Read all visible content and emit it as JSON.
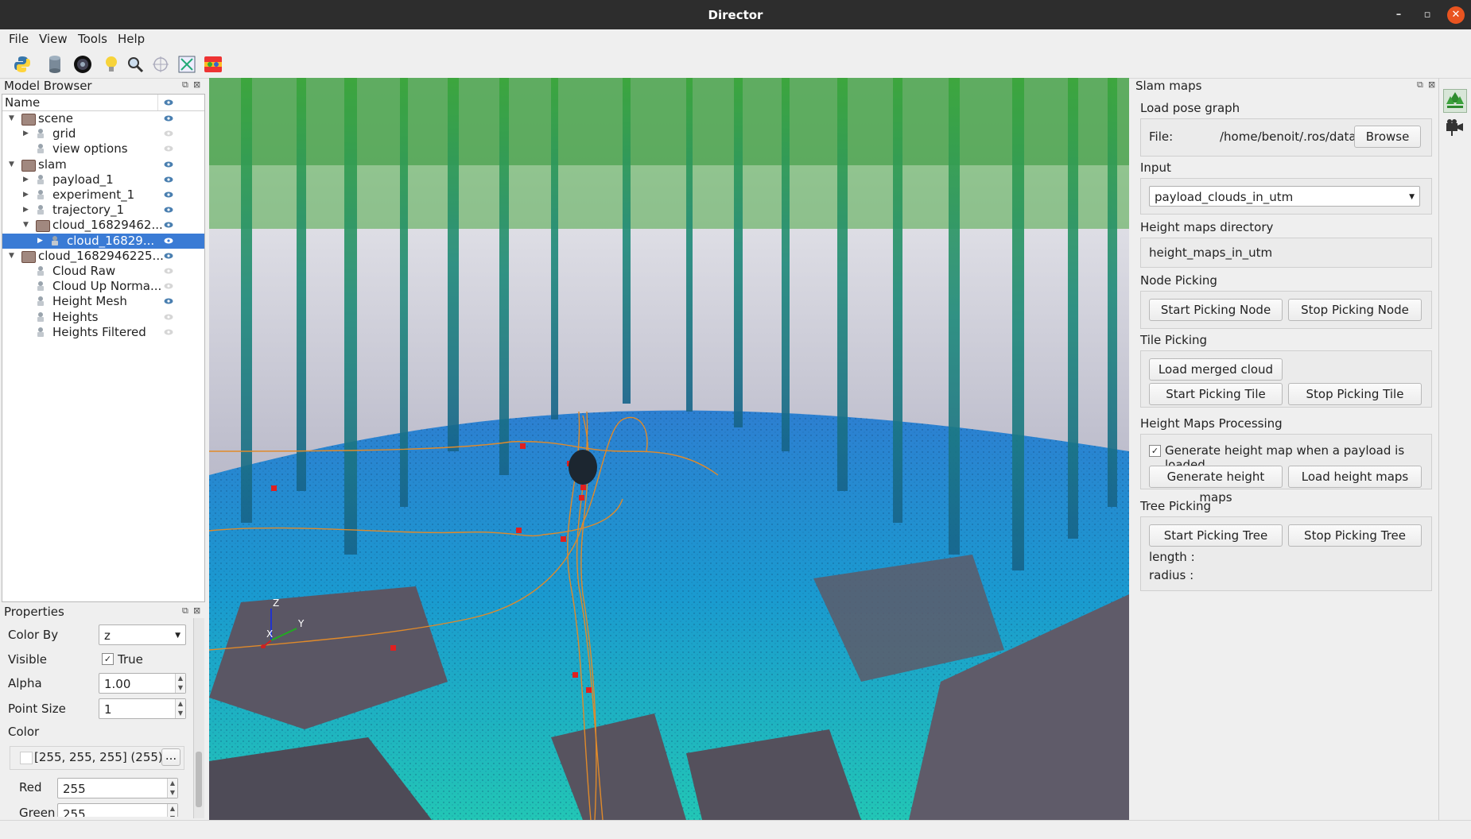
{
  "window": {
    "title": "Director"
  },
  "menu": [
    "File",
    "View",
    "Tools",
    "Help"
  ],
  "toolbar": {
    "icons": [
      "python-icon",
      "cylinder-icon",
      "camera-lens-icon",
      "lightbulb-icon",
      "magnifier-icon",
      "crosshair-icon",
      "fit-view-icon",
      "colormap-icon"
    ]
  },
  "model_browser": {
    "title": "Model Browser",
    "column_name": "Name",
    "items": [
      {
        "label": "scene",
        "level": 0,
        "expand": "open",
        "icon": "folder",
        "visible": true
      },
      {
        "label": "grid",
        "level": 1,
        "expand": "closed",
        "icon": "object",
        "visible": false
      },
      {
        "label": "view options",
        "level": 1,
        "expand": "none",
        "icon": "object",
        "visible": false
      },
      {
        "label": "slam",
        "level": 0,
        "expand": "open",
        "icon": "folder",
        "visible": true
      },
      {
        "label": "payload_1",
        "level": 1,
        "expand": "closed",
        "icon": "object",
        "visible": true
      },
      {
        "label": "experiment_1",
        "level": 1,
        "expand": "closed",
        "icon": "object",
        "visible": true
      },
      {
        "label": "trajectory_1",
        "level": 1,
        "expand": "closed",
        "icon": "object",
        "visible": true
      },
      {
        "label": "cloud_16829462...",
        "level": 1,
        "expand": "open",
        "icon": "folder",
        "visible": true
      },
      {
        "label": "cloud_16829...",
        "level": 2,
        "expand": "closed",
        "icon": "object",
        "visible": true,
        "selected": true
      },
      {
        "label": "cloud_1682946225...",
        "level": 0,
        "expand": "open",
        "icon": "folder",
        "visible": true
      },
      {
        "label": "Cloud Raw",
        "level": 1,
        "expand": "none",
        "icon": "object",
        "visible": false
      },
      {
        "label": "Cloud Up Norma...",
        "level": 1,
        "expand": "none",
        "icon": "object",
        "visible": false
      },
      {
        "label": "Height Mesh",
        "level": 1,
        "expand": "none",
        "icon": "object",
        "visible": true
      },
      {
        "label": "Heights",
        "level": 1,
        "expand": "none",
        "icon": "object",
        "visible": false
      },
      {
        "label": "Heights Filtered",
        "level": 1,
        "expand": "none",
        "icon": "object",
        "visible": false
      }
    ]
  },
  "properties": {
    "title": "Properties",
    "color_by_label": "Color By",
    "color_by_value": "z",
    "visible_label": "Visible",
    "visible_value": "True",
    "alpha_label": "Alpha",
    "alpha_value": "1.00",
    "point_size_label": "Point Size",
    "point_size_value": "1",
    "color_label": "Color",
    "color_value": "[255, 255, 255] (255)",
    "color_button": "...",
    "red_label": "Red",
    "red_value": "255",
    "green_label": "Green",
    "green_value": "255"
  },
  "slam_maps": {
    "title": "Slam maps",
    "load_pose_graph": {
      "title": "Load pose graph",
      "file_label": "File:",
      "file_path": "/home/benoit/.ros/data",
      "browse": "Browse"
    },
    "input": {
      "title": "Input",
      "value": "payload_clouds_in_utm"
    },
    "height_maps_directory": {
      "title": "Height maps directory",
      "value": "height_maps_in_utm"
    },
    "node_picking": {
      "title": "Node Picking",
      "start": "Start Picking Node",
      "stop": "Stop Picking Node"
    },
    "tile_picking": {
      "title": "Tile Picking",
      "load": "Load merged cloud",
      "start": "Start Picking Tile",
      "stop": "Stop Picking Tile"
    },
    "height_maps_processing": {
      "title": "Height Maps Processing",
      "checkbox": "Generate height map when a payload is loaded",
      "checked": true,
      "generate": "Generate height maps",
      "load": "Load height maps"
    },
    "tree_picking": {
      "title": "Tree Picking",
      "start": "Start Picking Tree",
      "stop": "Stop Picking Tree",
      "length_label": "length :",
      "radius_label": "radius :"
    }
  },
  "viewport": {
    "axes": {
      "z": "Z",
      "y": "Y",
      "x": "X"
    }
  },
  "right_toolbar": {
    "icons": [
      "tree-icon",
      "camera-icon"
    ]
  }
}
